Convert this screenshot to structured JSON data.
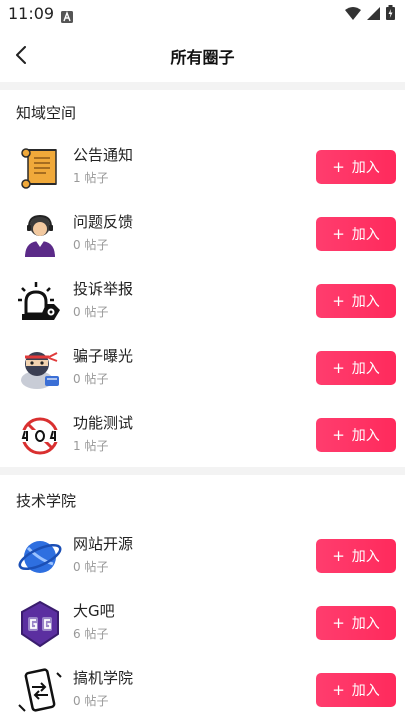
{
  "status_bar": {
    "time": "11:09",
    "icons": [
      "a-app-icon",
      "wifi-icon",
      "signal-icon",
      "battery-icon"
    ]
  },
  "header": {
    "title": "所有圈子"
  },
  "sections": [
    {
      "title": "知域空间",
      "items": [
        {
          "name": "公告通知",
          "count": "1 帖子",
          "icon": "scroll-notice-icon",
          "button": "加入"
        },
        {
          "name": "问题反馈",
          "count": "0 帖子",
          "icon": "customer-service-icon",
          "button": "加入"
        },
        {
          "name": "投诉举报",
          "count": "0 帖子",
          "icon": "alarm-report-icon",
          "button": "加入"
        },
        {
          "name": "骗子曝光",
          "count": "0 帖子",
          "icon": "ninja-scammer-icon",
          "button": "加入"
        },
        {
          "name": "功能测试",
          "count": "1 帖子",
          "icon": "no-404-icon",
          "button": "加入"
        }
      ]
    },
    {
      "title": "技术学院",
      "items": [
        {
          "name": "网站开源",
          "count": "0 帖子",
          "icon": "planet-icon",
          "button": "加入"
        },
        {
          "name": "大G吧",
          "count": "6 帖子",
          "icon": "gg-shield-icon",
          "button": "加入"
        },
        {
          "name": "搞机学院",
          "count": "0 帖子",
          "icon": "phone-transfer-icon",
          "button": "加入"
        }
      ]
    }
  ],
  "colors": {
    "accent": "#ff2f60",
    "divider": "#f3f3f3",
    "muted_text": "#999999"
  }
}
